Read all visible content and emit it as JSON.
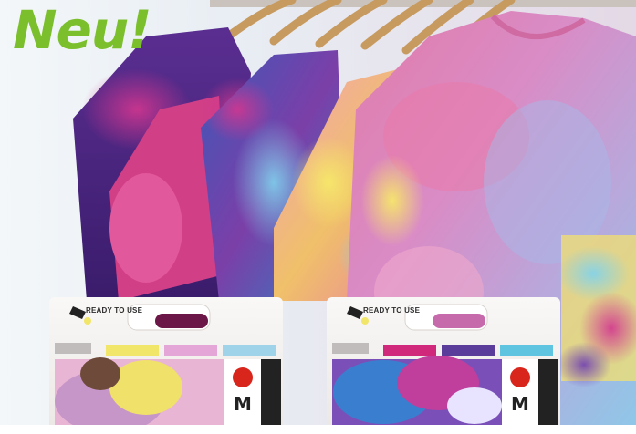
{
  "headline": {
    "text": "Neu!",
    "color": "#7cbf2d"
  },
  "packages": [
    {
      "tag": "READY TO USE",
      "brand_letter": "M",
      "swatches": [
        "#f2e66a",
        "#e3a6d6",
        "#9fd3ea"
      ],
      "window_color": "#6b1747"
    },
    {
      "tag": "READY TO USE",
      "brand_letter": "M",
      "swatches": [
        "#d0287b",
        "#5a3d9b",
        "#5fc4e0"
      ],
      "window_color": "#c76aac"
    }
  ],
  "colors": {
    "brand_red": "#d8261c",
    "card": "#f6f4f2",
    "sky": "#eef4f8"
  }
}
